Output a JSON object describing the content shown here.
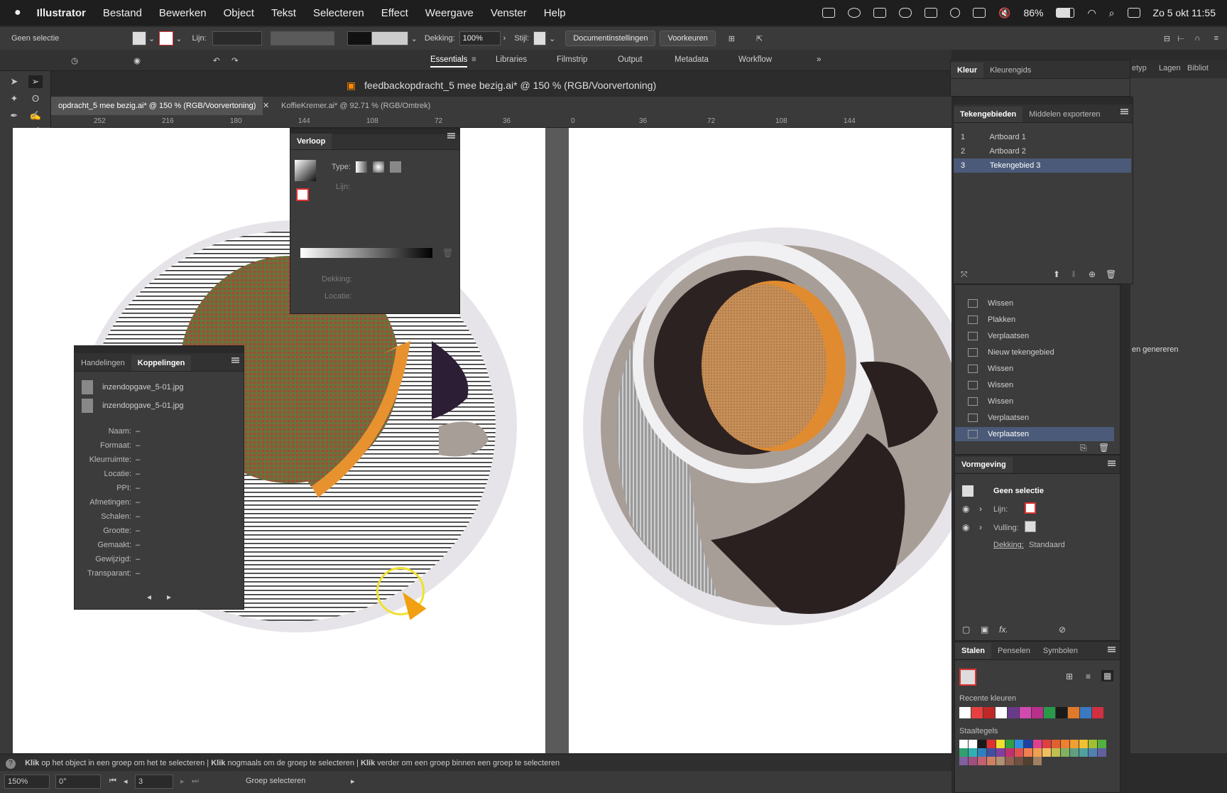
{
  "menubar": {
    "app": "Illustrator",
    "items": [
      "Bestand",
      "Bewerken",
      "Object",
      "Tekst",
      "Selecteren",
      "Effect",
      "Weergave",
      "Venster",
      "Help"
    ],
    "battery": "86%",
    "clock": "Zo 5 okt  11:55"
  },
  "control": {
    "selection": "Geen selectie",
    "stroke_label": "Lijn:",
    "opacity_label": "Dekking:",
    "opacity_value": "100%",
    "style_label": "Stijl:",
    "doc_settings": "Documentinstellingen",
    "prefs": "Voorkeuren"
  },
  "workspaces": [
    "Essentials",
    "Libraries",
    "Filmstrip",
    "Output",
    "Metadata",
    "Workflow"
  ],
  "document": {
    "title": "feedbackopdracht_5 mee bezig.ai* @ 150 % (RGB/Voorvertoning)",
    "tab1": "opdracht_5 mee bezig.ai* @ 150 % (RGB/Voorvertoning)",
    "tab2": "KoffieKremer.ai* @ 92.71 % (RGB/Omtrek)"
  },
  "ruler": [
    "252",
    "216",
    "180",
    "144",
    "108",
    "72",
    "36",
    "0",
    "36",
    "72",
    "108",
    "144"
  ],
  "gradient_panel": {
    "title": "Verloop",
    "type_label": "Type:",
    "stroke_label": "Lijn:",
    "opacity_label": "Dekking:",
    "location_label": "Locatie:"
  },
  "links_panel": {
    "tab_actions": "Handelingen",
    "tab_links": "Koppelingen",
    "files": [
      "inzendopgave_5-01.jpg",
      "inzendopgave_5-01.jpg"
    ],
    "fields": [
      {
        "label": "Naam:",
        "value": "–"
      },
      {
        "label": "Formaat:",
        "value": "–"
      },
      {
        "label": "Kleurruimte:",
        "value": "–"
      },
      {
        "label": "Locatie:",
        "value": "–"
      },
      {
        "label": "PPI:",
        "value": "–"
      },
      {
        "label": "Afmetingen:",
        "value": "–"
      },
      {
        "label": "Schalen:",
        "value": "–"
      },
      {
        "label": "Grootte:",
        "value": "–"
      },
      {
        "label": "Gemaakt:",
        "value": "–"
      },
      {
        "label": "Gewijzigd:",
        "value": "–"
      },
      {
        "label": "Transparant:",
        "value": "–"
      }
    ]
  },
  "color_panel": {
    "tab1": "Kleur",
    "tab2": "Kleurengids",
    "side_tabs": [
      "etyp",
      "Lagen",
      "Bibliot"
    ]
  },
  "artboards_panel": {
    "tab1": "Tekengebieden",
    "tab2": "Middelen exporteren",
    "rows": [
      {
        "num": "1",
        "name": "Artboard 1"
      },
      {
        "num": "2",
        "name": "Artboard 2"
      },
      {
        "num": "3",
        "name": "Tekengebied 3"
      }
    ]
  },
  "history": [
    "Wissen",
    "Plakken",
    "Verplaatsen",
    "Nieuw tekengebied",
    "Wissen",
    "Wissen",
    "Wissen",
    "Verplaatsen",
    "Verplaatsen"
  ],
  "side": {
    "generate": "en genereren"
  },
  "appearance": {
    "title": "Vormgeving",
    "selection": "Geen selectie",
    "stroke": "Lijn:",
    "fill": "Vulling:",
    "opacity": "Dekking:",
    "opacity_value": "Standaard"
  },
  "swatches": {
    "tab1": "Stalen",
    "tab2": "Penselen",
    "tab3": "Symbolen",
    "recent": "Recente kleuren",
    "tiles": "Staaltegels",
    "recent_colors": [
      "#ffffff",
      "#e84040",
      "#c02828",
      "#ffffff",
      "#6a3a8a",
      "#d04ab0",
      "#b8308a",
      "#2a9a4a",
      "#1a1a1a",
      "#e07a2a",
      "#3a7ac0",
      "#d03040"
    ],
    "grid_colors": [
      "#ffffff",
      "#ffffff",
      "#1a1a1a",
      "#e03030",
      "#f0e030",
      "#30a040",
      "#3090e0",
      "#2040a0",
      "#e04090",
      "#e04040",
      "#e06030",
      "#f08030",
      "#f0a030",
      "#f0c030",
      "#a0c030",
      "#50b040",
      "#30a070",
      "#30b0b0",
      "#3080c0",
      "#4050a0",
      "#8040a0",
      "#c03070",
      "#e05050",
      "#f08050",
      "#f0a050",
      "#f0c060",
      "#c0c050",
      "#80b060",
      "#60a080",
      "#50a0a0",
      "#5080b0",
      "#6060a0",
      "#8060a0",
      "#a05080",
      "#c06070",
      "#d08060",
      "#b09070",
      "#906050",
      "#705040",
      "#504030",
      "#a08060"
    ]
  },
  "status": {
    "click1": "Klik",
    "text1": "op het object in een groep om het te selecteren",
    "click2": "Klik",
    "text2": "nogmaals om de groep te selecteren",
    "click3": "Klik",
    "text3": "verder om een groep binnen een groep te selecteren"
  },
  "bottom": {
    "zoom": "150%",
    "rotation": "0°",
    "artboard": "3",
    "tool": "Groep selecteren"
  }
}
